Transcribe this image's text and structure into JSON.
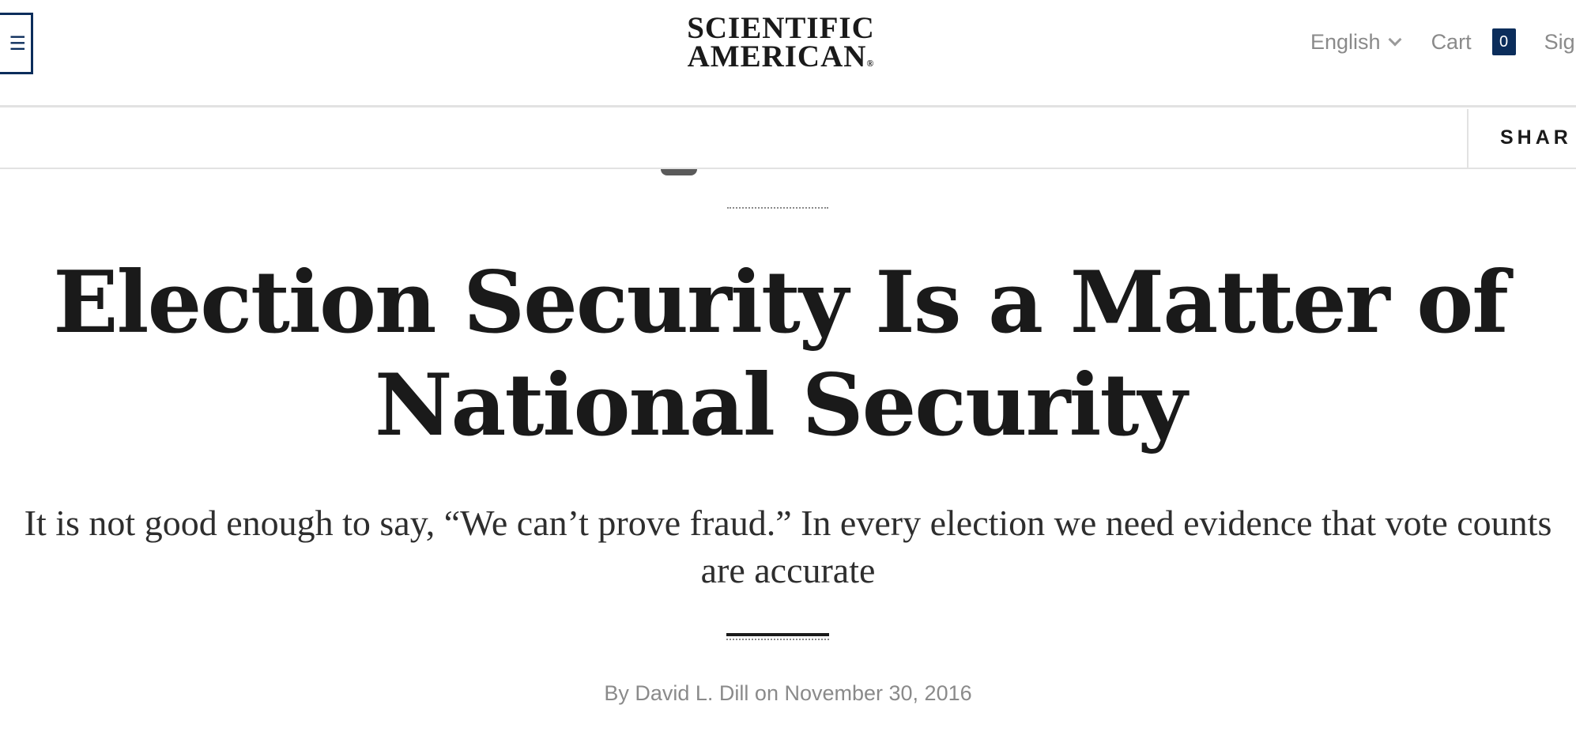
{
  "header": {
    "logo_line1": "SCIENTIFIC",
    "logo_line2": "AMERICAN",
    "logo_mark": "®",
    "menu_glyph": "☰",
    "language": "English",
    "cart_label": "Cart",
    "cart_count": "0",
    "signin_label": "Sig"
  },
  "share_bar": {
    "share_label": "SHAR"
  },
  "article": {
    "headline": "Election Security Is a Matter of National Security",
    "dek": "It is not good enough to say, “We can’t prove fraud.” In every election we need evidence that vote counts are accurate",
    "byline_prefix": "By ",
    "author": "David L. Dill",
    "byline_sep": " on ",
    "date": "November 30, 2016"
  },
  "colors": {
    "brand_navy": "#0b2d5b",
    "text_primary": "#1a1a1a",
    "text_muted": "#8a8a8a",
    "rule": "#e2e2e2"
  }
}
